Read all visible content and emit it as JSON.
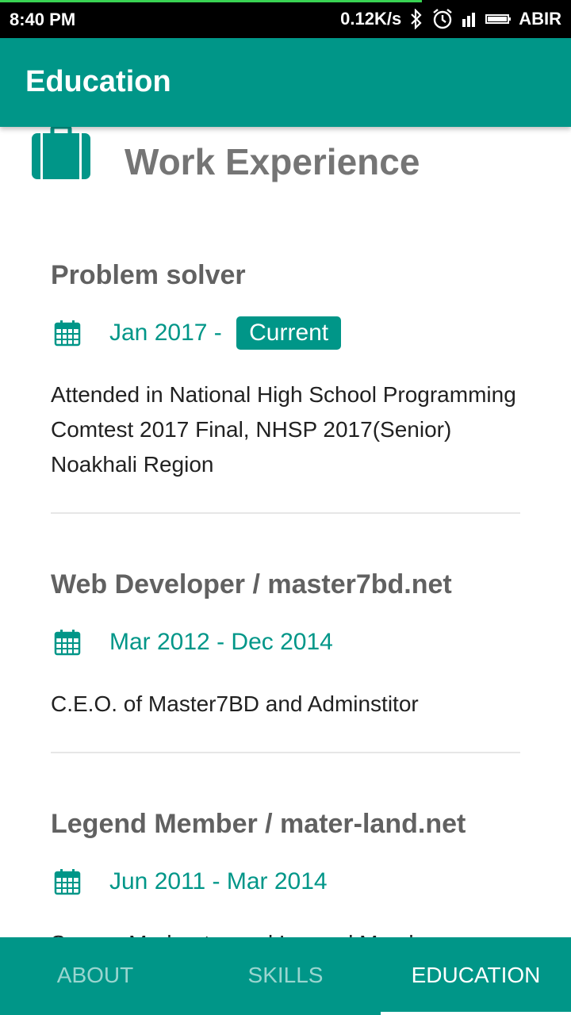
{
  "status_bar": {
    "time": "8:40 PM",
    "network_speed": "0.12K/s",
    "carrier": "ABIR",
    "icons": [
      "bluetooth-icon",
      "alarm-icon",
      "signal-icon",
      "battery-icon"
    ]
  },
  "app_bar": {
    "title": "Education"
  },
  "section": {
    "title": "Work Experience",
    "icon": "briefcase-icon"
  },
  "entries": [
    {
      "title": "Problem solver",
      "date": "Jan 2017 - ",
      "badge": "Current",
      "description": "Attended in National High School Programming Comtest 2017 Final, NHSP 2017(Senior) Noakhali Region"
    },
    {
      "title": "Web Developer / master7bd.net",
      "date": "Mar 2012 - Dec 2014",
      "description": "C.E.O. of Master7BD and Adminstitor"
    },
    {
      "title": "Legend Member / mater-land.net",
      "date": "Jun 2011 - Mar 2014",
      "description": "Supper Moderator and Legend Member"
    }
  ],
  "bottom_nav": {
    "tabs": [
      {
        "label": "ABOUT"
      },
      {
        "label": "SKILLS"
      },
      {
        "label": "EDUCATION"
      }
    ],
    "active": "EDUCATION"
  },
  "colors": {
    "primary": "#009688",
    "status_bar": "#000000",
    "title_text": "#616161",
    "body_text": "#212121"
  }
}
